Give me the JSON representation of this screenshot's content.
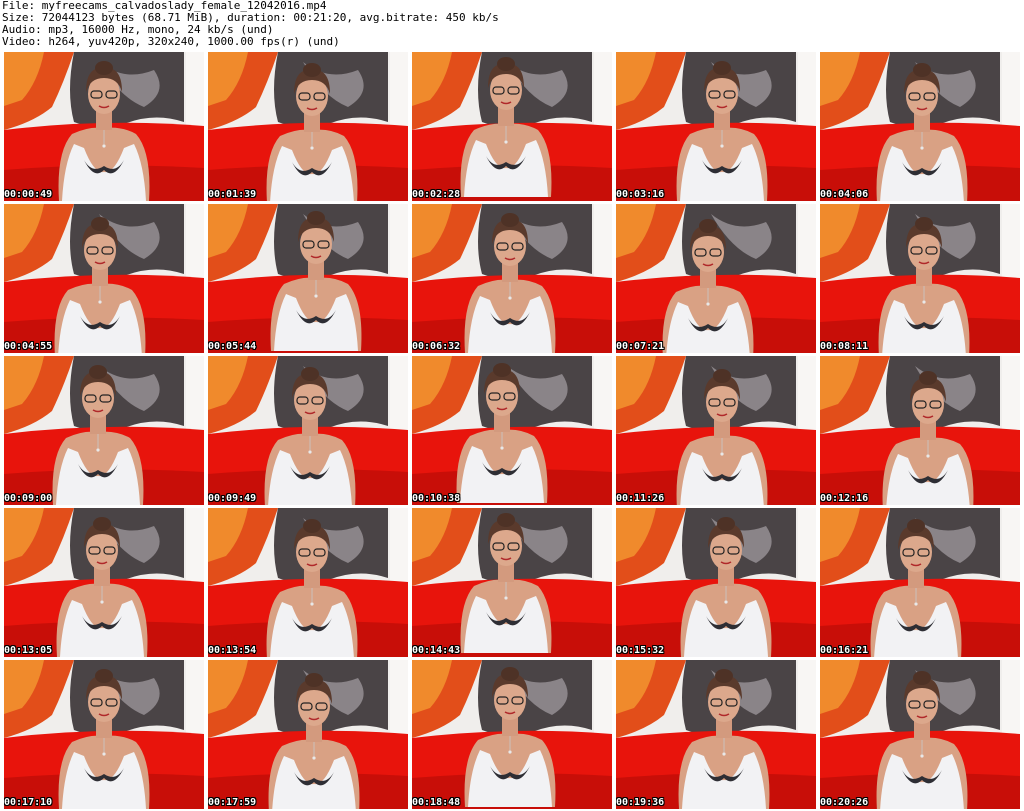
{
  "header": {
    "file": "File: myfreecams_calvadoslady_female_12042016.mp4",
    "size": "Size: 72044123 bytes (68.71 MiB), duration: 00:21:20, avg.bitrate: 450 kb/s",
    "audio": "Audio: mp3, 16000 Hz, mono, 24 kb/s (und)",
    "video": "Video: h264, yuv420p, 320x240, 1000.00 fps(r) (und)"
  },
  "colors": {
    "background": "#ffffff",
    "couch_red": "#e8140c",
    "wall_light": "#f0eeec",
    "backdrop_orange": "#e24e1a",
    "backdrop_dark": "#4a4446"
  },
  "thumbnails": [
    {
      "timestamp": "00:00:49"
    },
    {
      "timestamp": "00:01:39"
    },
    {
      "timestamp": "00:02:28"
    },
    {
      "timestamp": "00:03:16"
    },
    {
      "timestamp": "00:04:06"
    },
    {
      "timestamp": "00:04:55"
    },
    {
      "timestamp": "00:05:44"
    },
    {
      "timestamp": "00:06:32"
    },
    {
      "timestamp": "00:07:21"
    },
    {
      "timestamp": "00:08:11"
    },
    {
      "timestamp": "00:09:00"
    },
    {
      "timestamp": "00:09:49"
    },
    {
      "timestamp": "00:10:38"
    },
    {
      "timestamp": "00:11:26"
    },
    {
      "timestamp": "00:12:16"
    },
    {
      "timestamp": "00:13:05"
    },
    {
      "timestamp": "00:13:54"
    },
    {
      "timestamp": "00:14:43"
    },
    {
      "timestamp": "00:15:32"
    },
    {
      "timestamp": "00:16:21"
    },
    {
      "timestamp": "00:17:10"
    },
    {
      "timestamp": "00:17:59"
    },
    {
      "timestamp": "00:18:48"
    },
    {
      "timestamp": "00:19:36"
    },
    {
      "timestamp": "00:20:26"
    }
  ]
}
